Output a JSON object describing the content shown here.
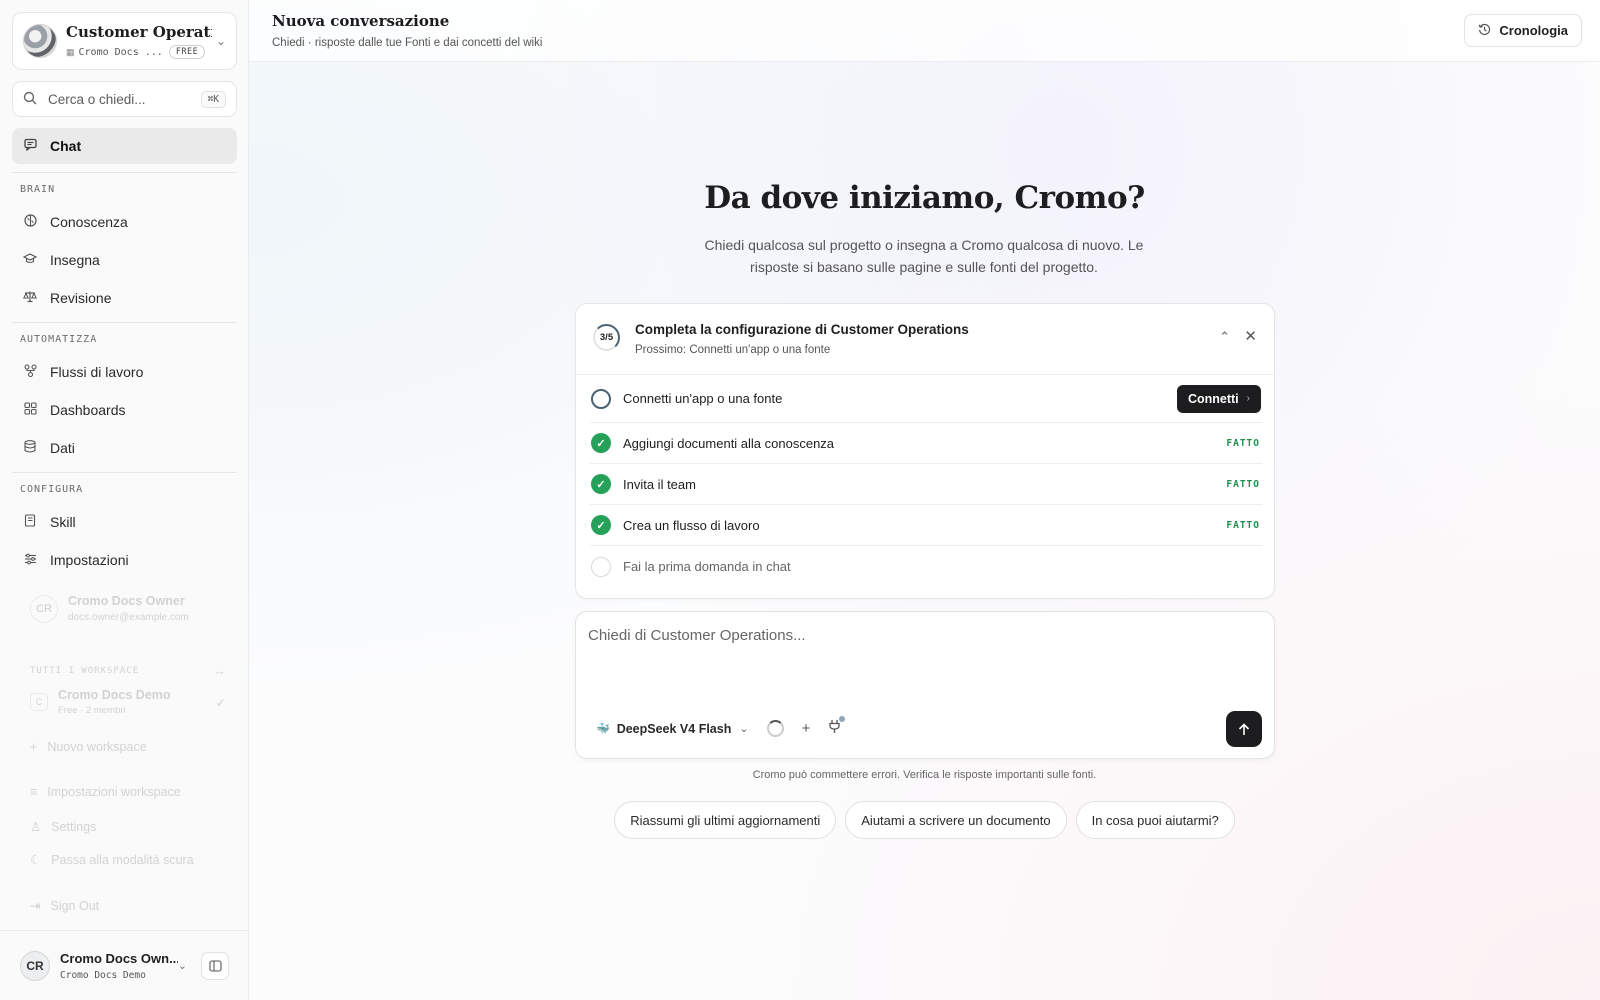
{
  "sidebar": {
    "workspace": {
      "name": "Customer Operati...",
      "org": "Cromo Docs ...",
      "plan": "FREE"
    },
    "search": {
      "placeholder": "Cerca o chiedi...",
      "shortcut": "⌘K"
    },
    "chat": {
      "label": "Chat"
    },
    "sections": [
      {
        "label": "BRAIN",
        "items": [
          {
            "label": "Conoscenza",
            "icon": "brain-icon"
          },
          {
            "label": "Insegna",
            "icon": "graduation-cap-icon"
          },
          {
            "label": "Revisione",
            "icon": "scale-icon"
          }
        ]
      },
      {
        "label": "AUTOMATIZZA",
        "items": [
          {
            "label": "Flussi di lavoro",
            "icon": "workflow-icon"
          },
          {
            "label": "Dashboards",
            "icon": "grid-icon"
          },
          {
            "label": "Dati",
            "icon": "database-icon"
          }
        ]
      },
      {
        "label": "CONFIGURA",
        "items": [
          {
            "label": "Skill",
            "icon": "book-icon"
          },
          {
            "label": "Impostazioni",
            "icon": "sliders-icon"
          }
        ]
      }
    ],
    "account_menu": {
      "avatar": "CR",
      "name": "Cromo Docs Owner",
      "email": "docs.owner@example.com",
      "all_workspaces": "TUTTI I WORKSPACE",
      "workspace_initial": "C",
      "workspace_name": "Cromo Docs Demo",
      "workspace_meta": "Free · 2 membri",
      "new_workspace": "Nuovo workspace",
      "workspace_settings": "Impostazioni workspace",
      "settings": "Settings",
      "dark_mode": "Passa alla modalità scura",
      "sign_out": "Sign Out"
    },
    "user": {
      "initials": "CR",
      "name": "Cromo Docs Own...",
      "org": "Cromo Docs Demo"
    }
  },
  "header": {
    "title": "Nuova conversazione",
    "subtitle": "Chiedi · risposte dalle tue Fonti e dai concetti del wiki",
    "history_label": "Cronologia"
  },
  "hero": {
    "title": "Da dove iniziamo, Cromo?",
    "subtitle": "Chiedi qualcosa sul progetto o insegna a Cromo qualcosa di nuovo. Le risposte si basano sulle pagine e sulle fonti del progetto."
  },
  "setup": {
    "progress": "3/5",
    "progress_fraction": 0.6,
    "title": "Completa la configurazione di Customer Operations",
    "next": "Prossimo: Connetti un'app o una fonte",
    "steps": [
      {
        "label": "Connetti un'app o una fonte",
        "status": "current",
        "action": "Connetti"
      },
      {
        "label": "Aggiungi documenti alla conoscenza",
        "status": "done",
        "tag": "FATTO"
      },
      {
        "label": "Invita il team",
        "status": "done",
        "tag": "FATTO"
      },
      {
        "label": "Crea un flusso di lavoro",
        "status": "done",
        "tag": "FATTO"
      },
      {
        "label": "Fai la prima domanda in chat",
        "status": "todo"
      }
    ]
  },
  "composer": {
    "placeholder": "Chiedi di Customer Operations...",
    "model": "DeepSeek V4 Flash"
  },
  "disclaimer": "Cromo può commettere errori. Verifica le risposte importanti sulle fonti.",
  "suggestions": [
    "Riassumi gli ultimi aggiornamenti",
    "Aiutami a scrivere un documento",
    "In cosa puoi aiutarmi?"
  ]
}
